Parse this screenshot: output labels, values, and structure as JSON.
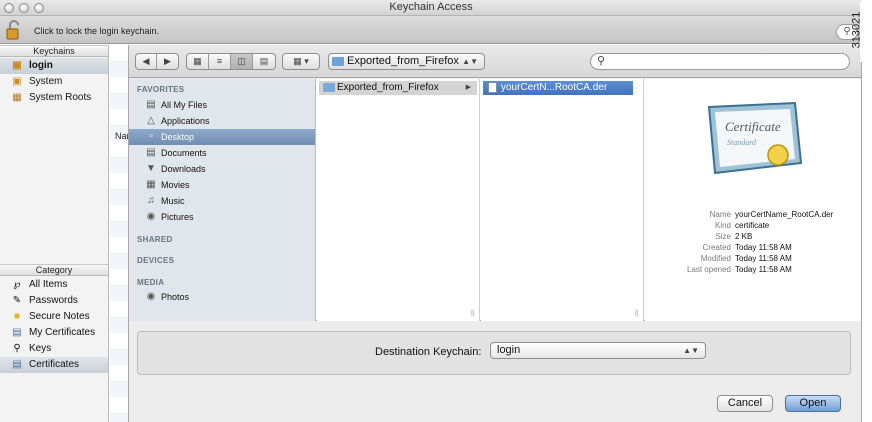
{
  "window": {
    "title": "Keychain Access"
  },
  "toolbar": {
    "lock_text": "Click to lock the login keychain."
  },
  "sidebar": {
    "keychains_header": "Keychains",
    "keychains": [
      {
        "label": "login",
        "icon": "lock-icon"
      },
      {
        "label": "System",
        "icon": "lock-icon"
      },
      {
        "label": "System Roots",
        "icon": "folder-icon"
      }
    ],
    "category_header": "Category",
    "categories": [
      {
        "label": "All Items",
        "icon": "keys-icon"
      },
      {
        "label": "Passwords",
        "icon": "pen-icon"
      },
      {
        "label": "Secure Notes",
        "icon": "note-icon"
      },
      {
        "label": "My Certificates",
        "icon": "certificate-icon"
      },
      {
        "label": "Keys",
        "icon": "key-icon"
      },
      {
        "label": "Certificates",
        "icon": "certificate-icon"
      }
    ]
  },
  "list": {
    "name_header": "Nan"
  },
  "sheet": {
    "path_popup": "Exported_from_Firefox",
    "search_value": "",
    "places": {
      "favorites_header": "FAVORITES",
      "favorites": [
        {
          "label": "All My Files",
          "icon": "files-icon"
        },
        {
          "label": "Applications",
          "icon": "applications-icon"
        },
        {
          "label": "Desktop",
          "icon": "desktop-icon"
        },
        {
          "label": "Documents",
          "icon": "documents-icon"
        },
        {
          "label": "Downloads",
          "icon": "download-icon"
        },
        {
          "label": "Movies",
          "icon": "movies-icon"
        },
        {
          "label": "Music",
          "icon": "music-icon"
        },
        {
          "label": "Pictures",
          "icon": "camera-icon"
        }
      ],
      "shared_header": "SHARED",
      "devices_header": "DEVICES",
      "media_header": "MEDIA",
      "media": [
        {
          "label": "Photos",
          "icon": "camera-icon"
        }
      ]
    },
    "columns": {
      "folder": "Exported_from_Firefox",
      "file": "yourCertN...RootCA.der"
    },
    "preview": {
      "cert_title": "Certificate",
      "cert_subtitle": "Standard",
      "info": [
        {
          "key": "Name",
          "value": "yourCertName_RootCA.der"
        },
        {
          "key": "Kind",
          "value": "certificate"
        },
        {
          "key": "Size",
          "value": "2 KB"
        },
        {
          "key": "Created",
          "value": "Today 11:58 AM"
        },
        {
          "key": "Modified",
          "value": "Today 11:58 AM"
        },
        {
          "key": "Last opened",
          "value": "Today 11:58 AM"
        }
      ]
    },
    "destination_label": "Destination Keychain:",
    "destination_value": "login",
    "cancel_label": "Cancel",
    "open_label": "Open"
  },
  "side_label": "313021",
  "colors": {
    "selection": "#3f72bf",
    "sidebar_bg": "#e1e6ec",
    "open_button": "#6f9fd8"
  }
}
